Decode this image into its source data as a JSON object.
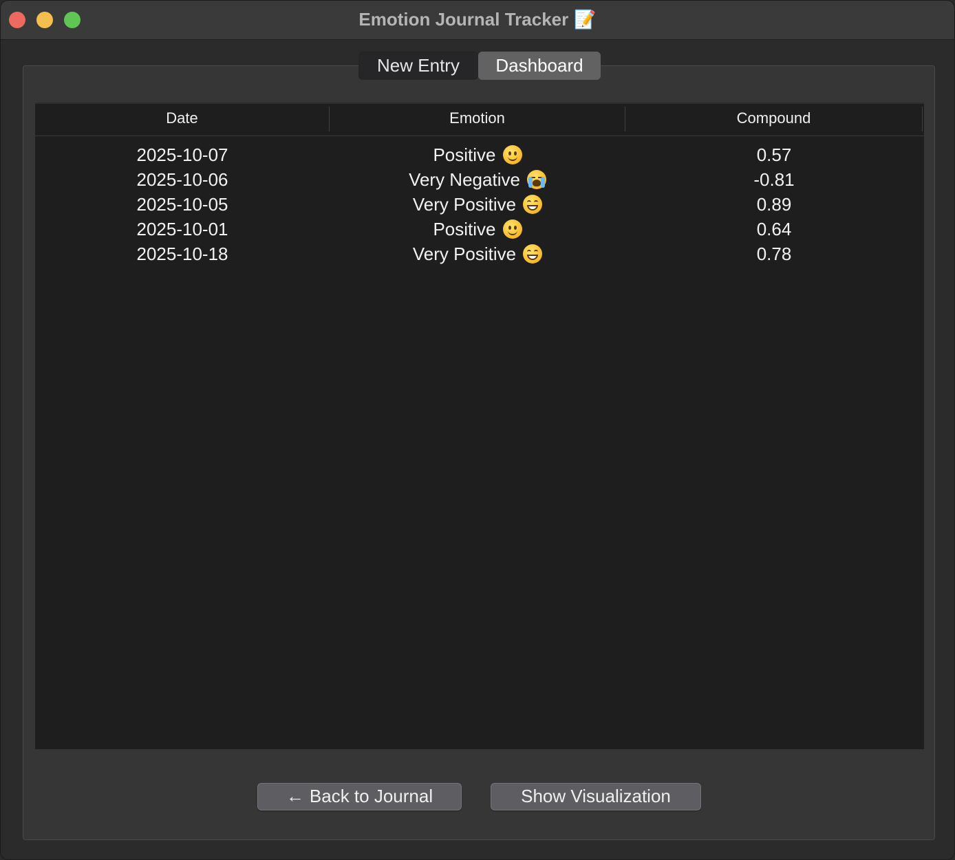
{
  "window": {
    "title": "Emotion Journal Tracker",
    "title_icon": "📝"
  },
  "tabs": [
    {
      "label": "New Entry",
      "active": false
    },
    {
      "label": "Dashboard",
      "active": true
    }
  ],
  "table": {
    "columns": [
      "Date",
      "Emotion",
      "Compound"
    ],
    "rows": [
      {
        "date": "2025-10-07",
        "emotion": "Positive",
        "emoji": "slightly-smiling-face",
        "compound": "0.57"
      },
      {
        "date": "2025-10-06",
        "emotion": "Very Negative",
        "emoji": "loudly-crying-face",
        "compound": "-0.81"
      },
      {
        "date": "2025-10-05",
        "emotion": "Very Positive",
        "emoji": "grinning-face",
        "compound": "0.89"
      },
      {
        "date": "2025-10-01",
        "emotion": "Positive",
        "emoji": "slightly-smiling-face",
        "compound": "0.64"
      },
      {
        "date": "2025-10-18",
        "emotion": "Very Positive",
        "emoji": "grinning-face",
        "compound": "0.78"
      }
    ]
  },
  "buttons": {
    "back_arrow": "←",
    "back_label": "Back to Journal",
    "viz_label": "Show Visualization"
  },
  "colors": {
    "close": "#ec6a5e",
    "minimize": "#f4bf4f",
    "maximize": "#61c554"
  }
}
